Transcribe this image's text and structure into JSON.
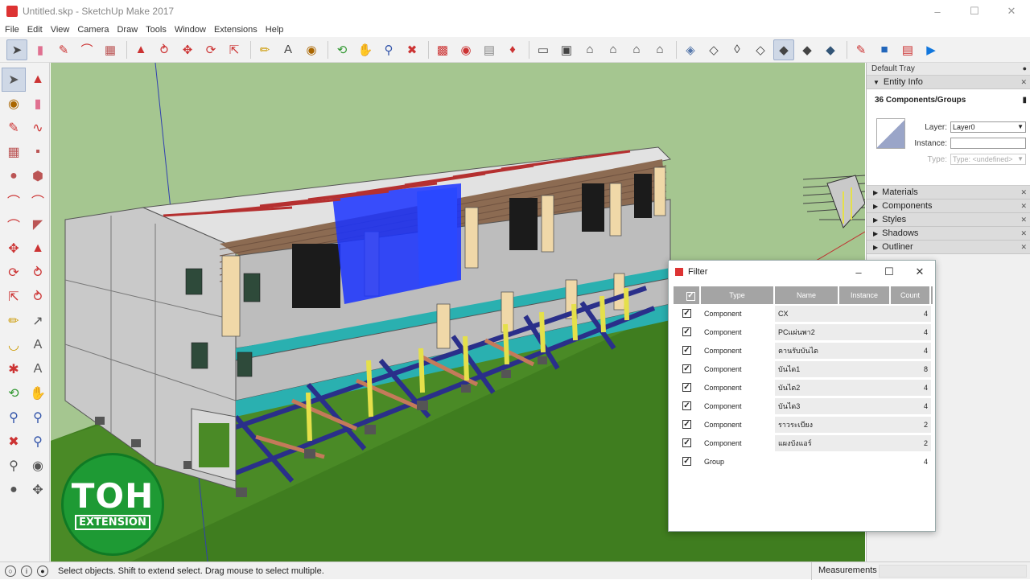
{
  "window": {
    "title": "Untitled.skp - SketchUp Make 2017"
  },
  "menu": [
    "File",
    "Edit",
    "View",
    "Camera",
    "Draw",
    "Tools",
    "Window",
    "Extensions",
    "Help"
  ],
  "tray": {
    "title": "Default Tray",
    "entity_info": {
      "label": "Entity Info",
      "selection": "36 Components/Groups",
      "layer_label": "Layer:",
      "layer_value": "Layer0",
      "instance_label": "Instance:",
      "instance_value": "",
      "type_label": "Type:",
      "type_value": "Type: <undefined>"
    },
    "sections": [
      "Materials",
      "Components",
      "Styles",
      "Shadows",
      "Outliner"
    ]
  },
  "filter": {
    "title": "Filter",
    "columns": [
      "Type",
      "Name",
      "Instance",
      "Count"
    ],
    "rows": [
      {
        "type": "Component",
        "name": "CX",
        "instance": "",
        "count": "4"
      },
      {
        "type": "Component",
        "name": "PCแผ่นพา2",
        "instance": "",
        "count": "4"
      },
      {
        "type": "Component",
        "name": "คานรับบันได",
        "instance": "",
        "count": "4"
      },
      {
        "type": "Component",
        "name": "บันได1",
        "instance": "",
        "count": "8"
      },
      {
        "type": "Component",
        "name": "บันได2",
        "instance": "",
        "count": "4"
      },
      {
        "type": "Component",
        "name": "บันได3",
        "instance": "",
        "count": "4"
      },
      {
        "type": "Component",
        "name": "ราวระเบียง",
        "instance": "",
        "count": "2"
      },
      {
        "type": "Component",
        "name": "แผงบังแอร์",
        "instance": "",
        "count": "2"
      },
      {
        "type": "Group",
        "name": "",
        "instance": "",
        "count": "4"
      }
    ]
  },
  "logo": {
    "big": "TOH",
    "small": "EXTENSION"
  },
  "status": {
    "message": "Select objects. Shift to extend select. Drag mouse to select multiple.",
    "measurements_label": "Measurements"
  },
  "colors": {
    "viewport_bg": "#a5c690",
    "ground": "#3f7d1f",
    "logo": "#1e9a34",
    "selection": "#1a33ff"
  }
}
